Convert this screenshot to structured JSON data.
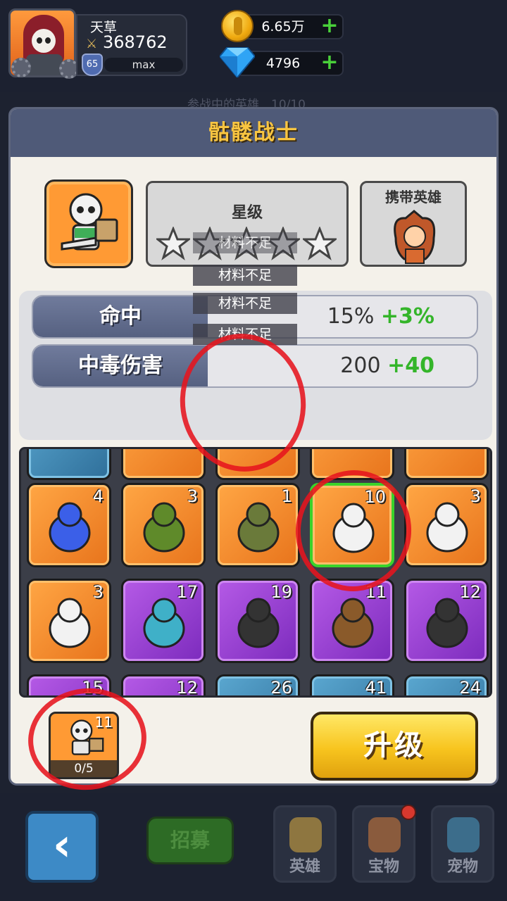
{
  "player": {
    "name": "天草",
    "power": "368762",
    "level": "65",
    "exp_label": "max"
  },
  "resources": {
    "gold": "6.65万",
    "gems": "4796"
  },
  "background_title": "参战中的英雄　10/10",
  "modal": {
    "title": "骷髅战士",
    "star_label": "星级",
    "star_count": 0,
    "star_max": 5,
    "carry_label": "携带英雄"
  },
  "stats": [
    {
      "name": "命中",
      "value": "15%",
      "plus": "+3%"
    },
    {
      "name": "中毒伤害",
      "value": "200",
      "plus": "+40"
    }
  ],
  "toasts": [
    "材料不足",
    "材料不足",
    "材料不足",
    "材料不足"
  ],
  "grid": {
    "rows": [
      [
        {
          "color": "blue",
          "count": ""
        },
        {
          "color": "orange",
          "count": ""
        },
        {
          "color": "orange",
          "count": ""
        },
        {
          "color": "orange",
          "count": ""
        },
        {
          "color": "orange",
          "count": ""
        }
      ],
      [
        {
          "color": "orange",
          "count": "4",
          "icon": "blue-slime-icon"
        },
        {
          "color": "orange",
          "count": "3",
          "icon": "green-dragon-icon"
        },
        {
          "color": "orange",
          "count": "1",
          "icon": "zombie-icon"
        },
        {
          "color": "orange",
          "count": "10",
          "icon": "skeleton-shield-icon",
          "selected": true
        },
        {
          "color": "orange",
          "count": "3",
          "icon": "skeleton-archer-icon"
        }
      ],
      [
        {
          "color": "orange",
          "count": "3",
          "icon": "skeleton-axe-icon"
        },
        {
          "color": "purple",
          "count": "17",
          "icon": "fish-monster-icon"
        },
        {
          "color": "purple",
          "count": "19",
          "icon": "scorpion-icon"
        },
        {
          "color": "purple",
          "count": "11",
          "icon": "treant-icon"
        },
        {
          "color": "purple",
          "count": "12",
          "icon": "crow-icon"
        }
      ],
      [
        {
          "color": "purple",
          "count": "15"
        },
        {
          "color": "purple",
          "count": "12"
        },
        {
          "color": "blue",
          "count": "26"
        },
        {
          "color": "blue",
          "count": "41"
        },
        {
          "color": "blue",
          "count": "24"
        }
      ]
    ]
  },
  "upgrade": {
    "card_count": "11",
    "progress": "0/5",
    "button_label": "升级"
  },
  "bottom_nav": {
    "recruit": "招募",
    "hero": "英雄",
    "treasure": "宝物",
    "pet": "宠物"
  },
  "colors": {
    "accent_title": "#f8c541",
    "plus_green": "#34b52a",
    "annotation_red": "#e6141e"
  }
}
